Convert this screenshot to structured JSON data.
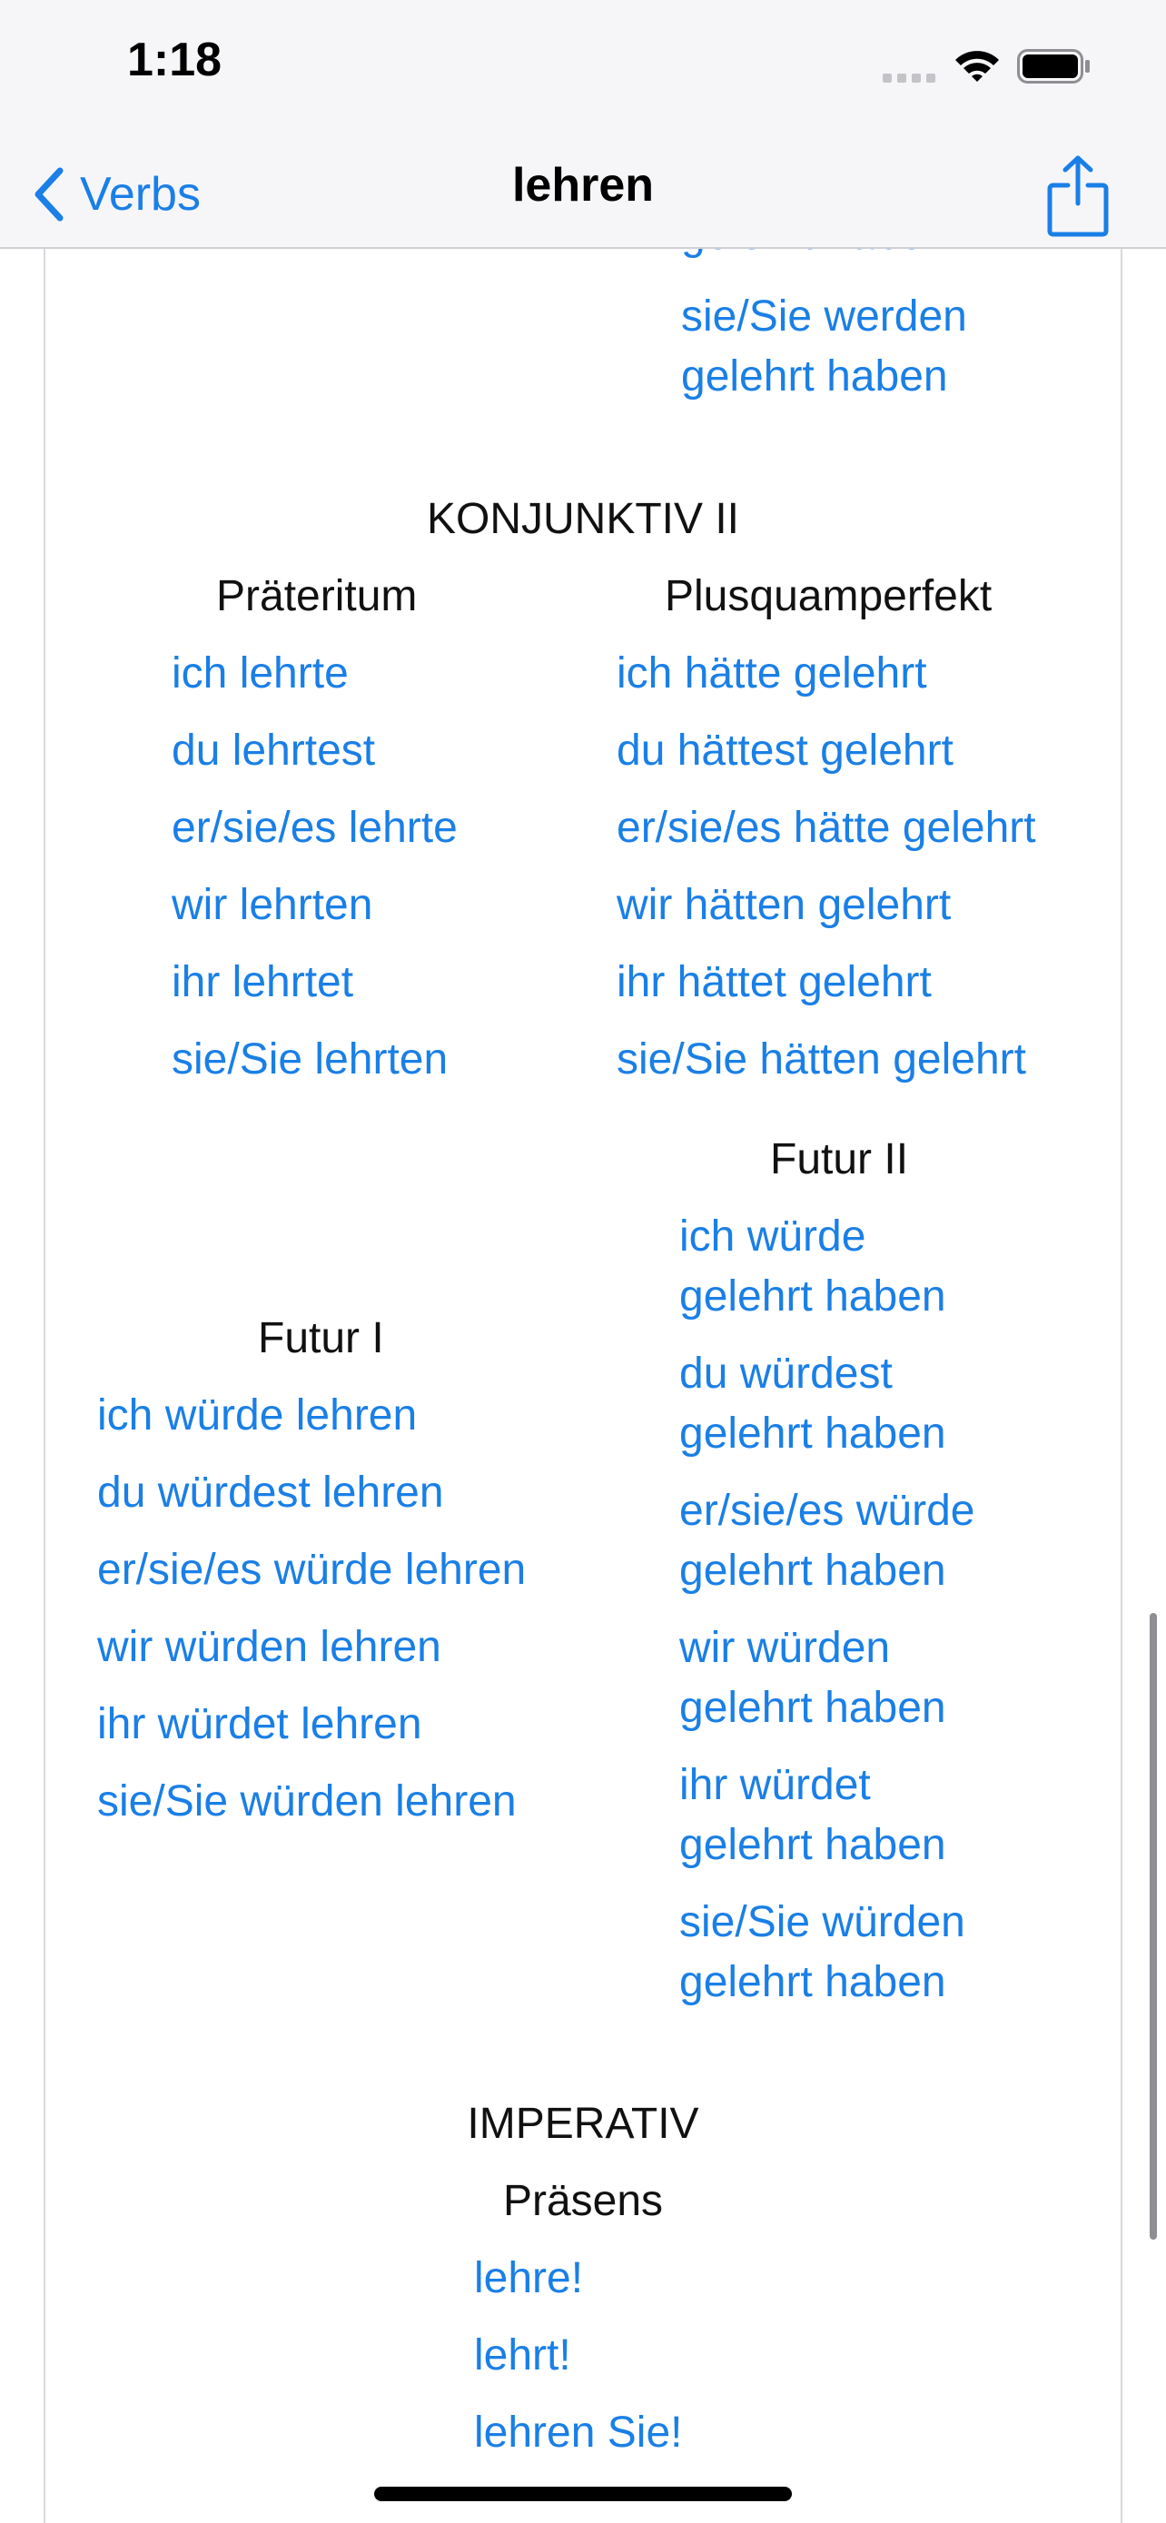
{
  "status_bar": {
    "time": "1:18"
  },
  "nav": {
    "back_label": "Verbs",
    "title": "lehren",
    "accent_color": "#1a7fe6"
  },
  "top_partial": {
    "clipped_line": "gelehrt haben",
    "line1": "sie/Sie werden",
    "line2": "gelehrt haben"
  },
  "konjunktiv2": {
    "heading": "KONJUNKTIV II",
    "praeteritum": {
      "title": "Präteritum",
      "forms": [
        "ich lehrte",
        "du lehrtest",
        "er/sie/es lehrte",
        "wir lehrten",
        "ihr lehrtet",
        "sie/Sie lehrten"
      ]
    },
    "plusquamperfekt": {
      "title": "Plusquamperfekt",
      "forms": [
        "ich hätte gelehrt",
        "du hättest gelehrt",
        "er/sie/es hätte gelehrt",
        "wir hätten gelehrt",
        "ihr hättet gelehrt",
        "sie/Sie hätten gelehrt"
      ]
    },
    "futur1": {
      "title": "Futur I",
      "forms": [
        "ich würde lehren",
        "du würdest lehren",
        "er/sie/es würde lehren",
        "wir würden lehren",
        "ihr würdet lehren",
        "sie/Sie würden lehren"
      ]
    },
    "futur2": {
      "title": "Futur II",
      "forms": [
        [
          "ich würde",
          "gelehrt haben"
        ],
        [
          "du würdest",
          "gelehrt haben"
        ],
        [
          "er/sie/es würde",
          "gelehrt haben"
        ],
        [
          "wir würden",
          "gelehrt haben"
        ],
        [
          "ihr würdet",
          "gelehrt haben"
        ],
        [
          "sie/Sie würden",
          "gelehrt haben"
        ]
      ]
    }
  },
  "imperativ": {
    "heading": "IMPERATIV",
    "praesens": {
      "title": "Präsens",
      "forms": [
        "lehre!",
        "lehrt!",
        "lehren Sie!"
      ]
    }
  }
}
